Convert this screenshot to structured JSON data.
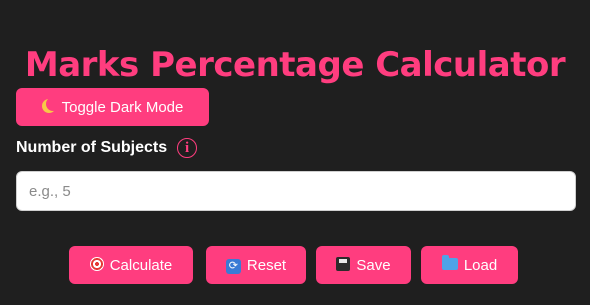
{
  "page": {
    "title": "Marks Percentage Calculator"
  },
  "theme_toggle": {
    "label": "Toggle Dark Mode",
    "icon": "crescent-moon-icon"
  },
  "subjects": {
    "label": "Number of Subjects",
    "info_glyph": "i",
    "input_value": "",
    "placeholder": "e.g., 5"
  },
  "actions": {
    "calculate": {
      "label": "Calculate",
      "icon": "target-icon"
    },
    "reset": {
      "label": "Reset",
      "icon": "refresh-icon"
    },
    "save": {
      "label": "Save",
      "icon": "floppy-disk-icon"
    },
    "load": {
      "label": "Load",
      "icon": "folder-icon"
    }
  },
  "colors": {
    "accent": "#ff3d7f",
    "background": "#1f1f1f",
    "text": "#ffffff",
    "input_background": "#ffffff"
  }
}
